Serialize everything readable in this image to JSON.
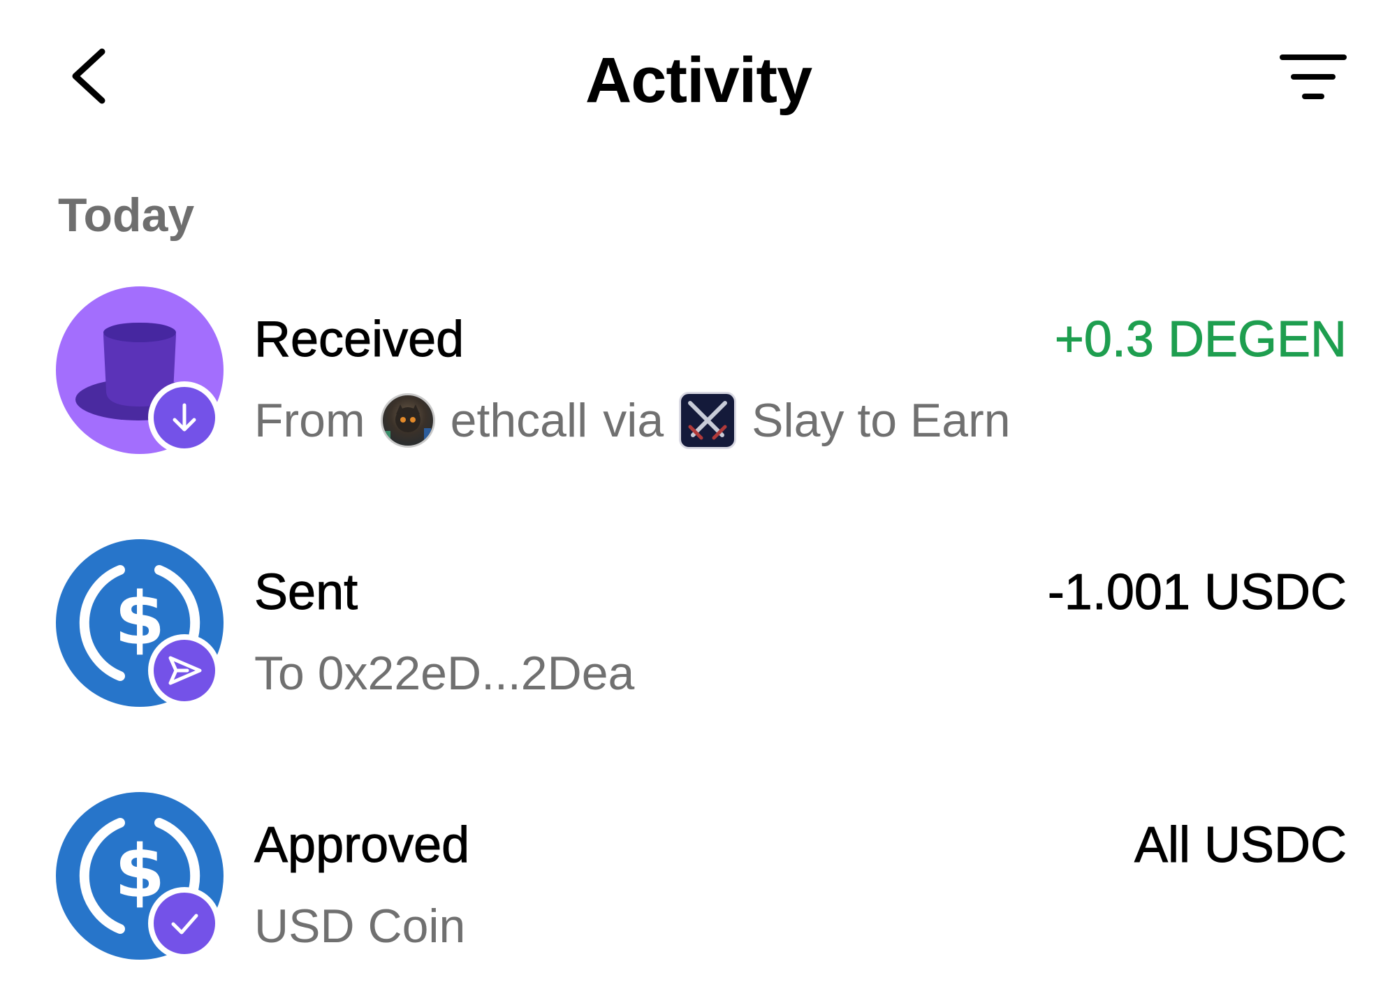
{
  "header": {
    "title": "Activity",
    "back_icon": "chevron-left-icon",
    "filter_icon": "filter-icon"
  },
  "section": {
    "label": "Today"
  },
  "transactions": [
    {
      "title": "Received",
      "amount": "+0.3 DEGEN",
      "amount_color": "#1e9e4f",
      "token_icon": "degen-tophat-icon",
      "badge_icon": "arrow-down-icon",
      "sub": {
        "prefix": "From",
        "user": "ethcall",
        "via": "via",
        "app": "Slay to Earn"
      }
    },
    {
      "title": "Sent",
      "amount": "-1.001 USDC",
      "amount_color": "#000000",
      "token_icon": "usdc-icon",
      "badge_icon": "send-icon",
      "sub": {
        "text": "To 0x22eD...2Dea"
      }
    },
    {
      "title": "Approved",
      "amount": "All USDC",
      "amount_color": "#000000",
      "token_icon": "usdc-icon",
      "badge_icon": "check-icon",
      "sub": {
        "text": "USD Coin"
      }
    }
  ],
  "colors": {
    "badge": "#7452e8",
    "degen": "#a36efd",
    "usdc": "#2775ca",
    "secondary_text": "#707070"
  }
}
